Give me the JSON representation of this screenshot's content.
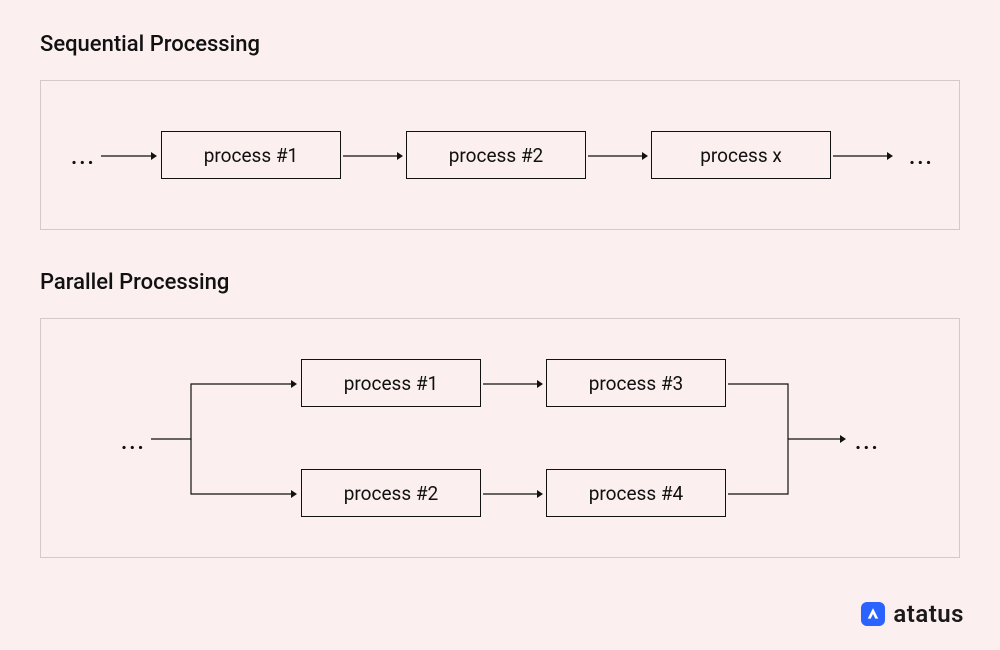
{
  "titles": {
    "sequential": "Sequential Processing",
    "parallel": "Parallel Processing"
  },
  "sequential": {
    "boxes": [
      "process #1",
      "process #2",
      "process x"
    ],
    "leading_ellipsis": "...",
    "trailing_ellipsis": "..."
  },
  "parallel": {
    "top_boxes": [
      "process #1",
      "process #3"
    ],
    "bottom_boxes": [
      "process #2",
      "process #4"
    ],
    "leading_ellipsis": "...",
    "trailing_ellipsis": "..."
  },
  "brand": {
    "name": "atatus"
  },
  "colors": {
    "bg": "#fbf0ef",
    "panel_border": "#d5cac9",
    "box_border": "#111111",
    "brand_icon": "#2b63ff"
  }
}
